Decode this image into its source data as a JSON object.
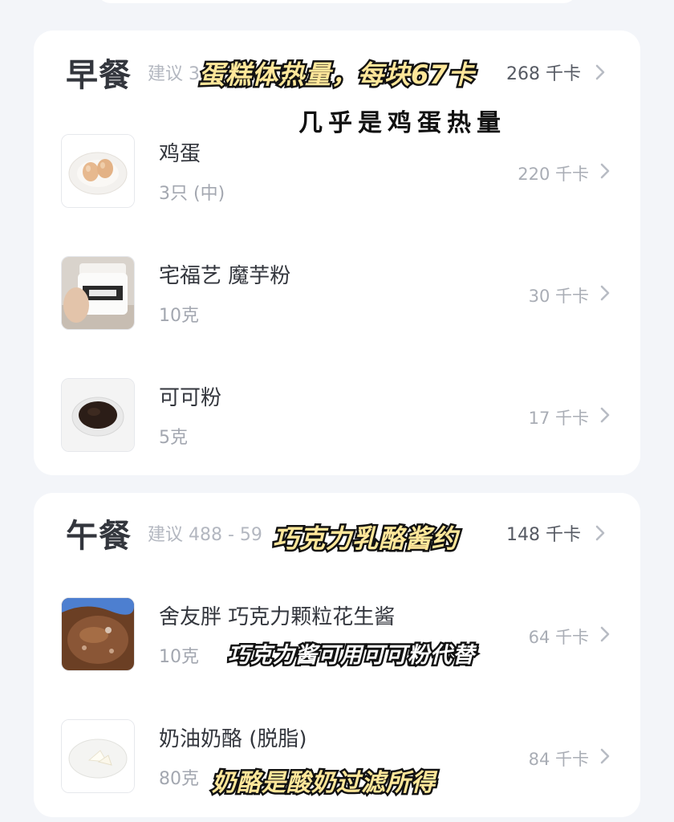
{
  "breakfast": {
    "title": "早餐",
    "suggestion": "建议 3",
    "total": "268 千卡",
    "items": [
      {
        "name": "鸡蛋",
        "amount": "3只 (中)",
        "calories": "220 千卡",
        "thumb_icon": "eggs-icon"
      },
      {
        "name": "宅福艺 魔芋粉",
        "amount": "10克",
        "calories": "30 千卡",
        "thumb_icon": "konjac-jar-icon"
      },
      {
        "name": "可可粉",
        "amount": "5克",
        "calories": "17 千卡",
        "thumb_icon": "cocoa-powder-icon"
      }
    ]
  },
  "lunch": {
    "title": "午餐",
    "suggestion": "建议 488 - 59",
    "total": "148 千卡",
    "items": [
      {
        "name": "舍友胖 巧克力颗粒花生酱",
        "amount": "10克",
        "calories": "64 千卡",
        "thumb_icon": "chocolate-spread-icon"
      },
      {
        "name": "奶油奶酪 (脱脂)",
        "amount": "80克",
        "calories": "84 千卡",
        "thumb_icon": "cream-cheese-icon"
      }
    ]
  },
  "captions": {
    "cake_calories": "蛋糕体热量，每块67卡",
    "almost_egg": "几乎是鸡蛋热量",
    "choco_cheese_sauce": "巧克力乳酪酱约",
    "choco_sub": "巧克力酱可用可可粉代替",
    "cheese_from_yogurt": "奶酪是酸奶过滤所得"
  },
  "colors": {
    "background": "#f3f5f9",
    "card": "#ffffff",
    "title": "#33363d",
    "muted": "#a3a7b0",
    "caption_fill": "#ffe79a",
    "caption_stroke": "#121212"
  }
}
